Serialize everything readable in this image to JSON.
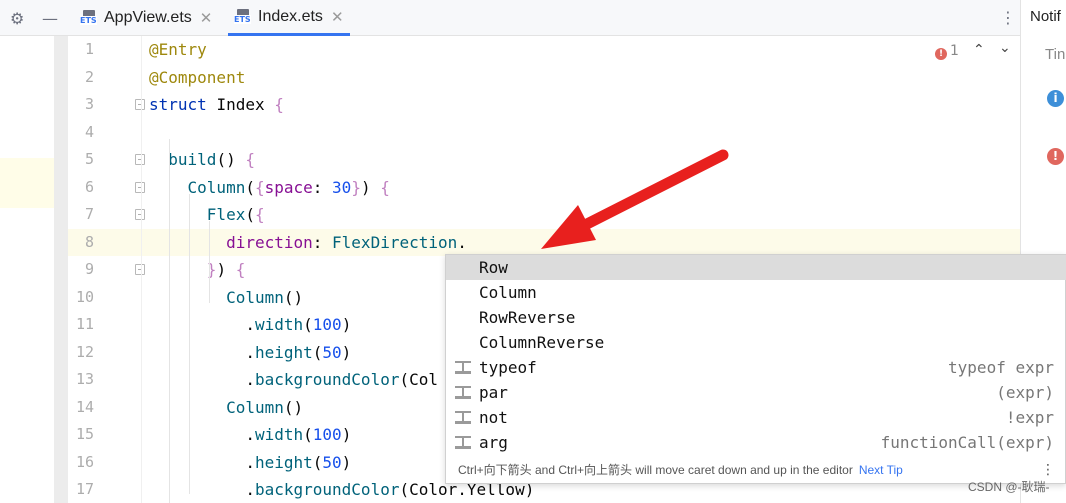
{
  "tabs": [
    {
      "label": "AppView.ets",
      "icon": "ets-file-icon",
      "active": false
    },
    {
      "label": "Index.ets",
      "icon": "ets-file-icon",
      "active": true
    }
  ],
  "ets_badge": "ETS",
  "inspection": {
    "count": "1"
  },
  "right_panel": {
    "title": "Notif",
    "subtitle": "Tin",
    "info_glyph": "i",
    "error_glyph": "!"
  },
  "lines": [
    {
      "n": "1",
      "tokens": [
        [
          "c-ann",
          "@Entry"
        ]
      ]
    },
    {
      "n": "2",
      "tokens": [
        [
          "c-ann",
          "@Component"
        ]
      ]
    },
    {
      "n": "3",
      "tokens": [
        [
          "c-kw",
          "struct "
        ],
        [
          "c-pl",
          "Index "
        ],
        [
          "k1",
          "{"
        ]
      ]
    },
    {
      "n": "4",
      "tokens": []
    },
    {
      "n": "5",
      "tokens": [
        [
          "c-pl",
          "  "
        ],
        [
          "c-fn",
          "build"
        ],
        [
          "c-pl",
          "() "
        ],
        [
          "k1",
          "{"
        ]
      ]
    },
    {
      "n": "6",
      "tokens": [
        [
          "c-pl",
          "    "
        ],
        [
          "c-fn",
          "Column"
        ],
        [
          "c-pl",
          "("
        ],
        [
          "k1",
          "{"
        ],
        [
          "c-prop",
          "space"
        ],
        [
          "c-pl",
          ": "
        ],
        [
          "c-num",
          "30"
        ],
        [
          "k1",
          "}"
        ],
        [
          "c-pl",
          ") "
        ],
        [
          "k1",
          "{"
        ]
      ]
    },
    {
      "n": "7",
      "tokens": [
        [
          "c-pl",
          "      "
        ],
        [
          "c-fn",
          "Flex"
        ],
        [
          "c-pl",
          "("
        ],
        [
          "k1",
          "{"
        ]
      ]
    },
    {
      "n": "8",
      "tokens": [
        [
          "c-pl",
          "        "
        ],
        [
          "c-prop",
          "direction"
        ],
        [
          "c-pl",
          ": "
        ],
        [
          "c-fn",
          "FlexDirection"
        ],
        [
          "c-pl",
          "."
        ]
      ]
    },
    {
      "n": "9",
      "tokens": [
        [
          "c-pl",
          "      "
        ],
        [
          "k1",
          "}"
        ],
        [
          "c-pl",
          ") "
        ],
        [
          "k1",
          "{"
        ]
      ]
    },
    {
      "n": "10",
      "tokens": [
        [
          "c-pl",
          "        "
        ],
        [
          "c-fn",
          "Column"
        ],
        [
          "c-pl",
          "()"
        ]
      ]
    },
    {
      "n": "11",
      "tokens": [
        [
          "c-pl",
          "          ."
        ],
        [
          "c-fn",
          "width"
        ],
        [
          "c-pl",
          "("
        ],
        [
          "c-num",
          "100"
        ],
        [
          "c-pl",
          ")"
        ]
      ]
    },
    {
      "n": "12",
      "tokens": [
        [
          "c-pl",
          "          ."
        ],
        [
          "c-fn",
          "height"
        ],
        [
          "c-pl",
          "("
        ],
        [
          "c-num",
          "50"
        ],
        [
          "c-pl",
          ")"
        ]
      ]
    },
    {
      "n": "13",
      "tokens": [
        [
          "c-pl",
          "          ."
        ],
        [
          "c-fn",
          "backgroundColor"
        ],
        [
          "c-pl",
          "(Col"
        ]
      ]
    },
    {
      "n": "14",
      "tokens": [
        [
          "c-pl",
          "        "
        ],
        [
          "c-fn",
          "Column"
        ],
        [
          "c-pl",
          "()"
        ]
      ]
    },
    {
      "n": "15",
      "tokens": [
        [
          "c-pl",
          "          ."
        ],
        [
          "c-fn",
          "width"
        ],
        [
          "c-pl",
          "("
        ],
        [
          "c-num",
          "100"
        ],
        [
          "c-pl",
          ")"
        ]
      ]
    },
    {
      "n": "16",
      "tokens": [
        [
          "c-pl",
          "          ."
        ],
        [
          "c-fn",
          "height"
        ],
        [
          "c-pl",
          "("
        ],
        [
          "c-num",
          "50"
        ],
        [
          "c-pl",
          ")"
        ]
      ]
    },
    {
      "n": "17",
      "tokens": [
        [
          "c-pl",
          "          ."
        ],
        [
          "c-fn",
          "backgroundColor"
        ],
        [
          "c-pl",
          "(Color.Yellow)"
        ]
      ]
    }
  ],
  "completion": {
    "items": [
      {
        "name": "Row",
        "tail": "",
        "template": false
      },
      {
        "name": "Column",
        "tail": "",
        "template": false
      },
      {
        "name": "RowReverse",
        "tail": "",
        "template": false
      },
      {
        "name": "ColumnReverse",
        "tail": "",
        "template": false
      },
      {
        "name": "typeof",
        "tail": "typeof expr",
        "template": true
      },
      {
        "name": "par",
        "tail": "(expr)",
        "template": true
      },
      {
        "name": "not",
        "tail": "!expr",
        "template": true
      },
      {
        "name": "arg",
        "tail": "functionCall(expr)",
        "template": true
      }
    ],
    "hint": "Ctrl+向下箭头 and Ctrl+向上箭头 will move caret down and up in the editor",
    "next_tip": "Next Tip"
  },
  "watermark": "CSDN @-耿瑞-",
  "colors": {
    "accent": "#3574f0",
    "arrow": "#e8201e",
    "error": "#e0675e",
    "info": "#3d8fd8"
  }
}
